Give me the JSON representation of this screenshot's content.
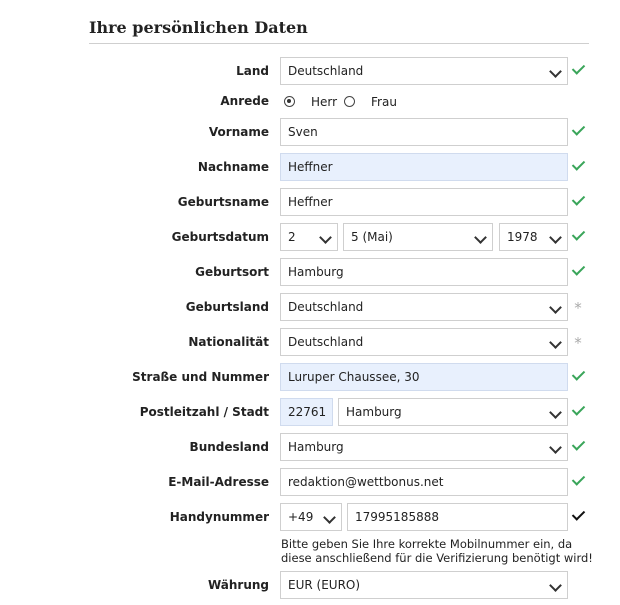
{
  "section_title": "Ihre persönlichen Daten",
  "fields": {
    "land": {
      "label": "Land",
      "value": "Deutschland"
    },
    "anrede": {
      "label": "Anrede",
      "options": [
        "Herr",
        "Frau"
      ],
      "selected": "Herr"
    },
    "vorname": {
      "label": "Vorname",
      "value": "Sven"
    },
    "nachname": {
      "label": "Nachname",
      "value": "Heffner"
    },
    "geburtsname": {
      "label": "Geburtsname",
      "value": "Heffner"
    },
    "geburtsdatum": {
      "label": "Geburtsdatum",
      "day": "2",
      "month": "5 (Mai)",
      "year": "1978"
    },
    "geburtsort": {
      "label": "Geburtsort",
      "value": "Hamburg"
    },
    "geburtsland": {
      "label": "Geburtsland",
      "value": "Deutschland"
    },
    "nationalitaet": {
      "label": "Nationalität",
      "value": "Deutschland"
    },
    "strasse": {
      "label": "Straße und Nummer",
      "value": "Luruper Chaussee, 30"
    },
    "plz_stadt": {
      "label": "Postleitzahl / Stadt",
      "plz": "22761",
      "stadt": "Hamburg"
    },
    "bundesland": {
      "label": "Bundesland",
      "value": "Hamburg"
    },
    "email": {
      "label": "E-Mail-Adresse",
      "value": "redaktion@wettbonus.net"
    },
    "handy": {
      "label": "Handynummer",
      "prefix": "+49",
      "number": "17995185888",
      "hint": "Bitte geben Sie Ihre korrekte Mobilnummer ein, da diese anschließend für die Verifizierung benötigt wird!"
    },
    "waehrung": {
      "label": "Währung",
      "value": "EUR (EURO)"
    }
  },
  "status_symbols": {
    "valid": "check-icon",
    "required": "*"
  },
  "colors": {
    "valid": "#3aa55a",
    "highlight_bg": "#e8f0fd"
  }
}
